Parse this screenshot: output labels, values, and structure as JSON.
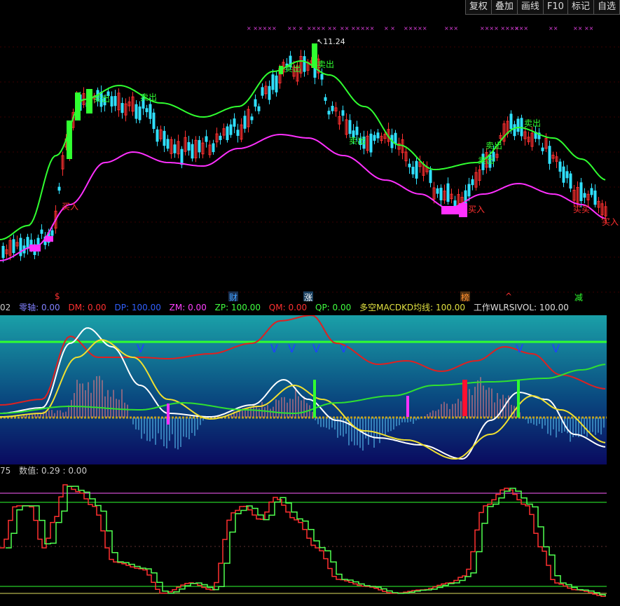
{
  "toolbar": {
    "buttons": [
      "复权",
      "叠加",
      "画线",
      "F10",
      "标记",
      "自选"
    ]
  },
  "main_chart": {
    "high_label": "11.24",
    "signals": [
      {
        "text": "卖出",
        "color": "#30ff30"
      },
      {
        "text": "卖出",
        "color": "#30ff30"
      },
      {
        "text": "卖出",
        "color": "#30ff30"
      },
      {
        "text": "卖出",
        "color": "#30ff30"
      },
      {
        "text": "卖出",
        "color": "#30ff30"
      },
      {
        "text": "卖出",
        "color": "#30ff30"
      },
      {
        "text": "卖出",
        "color": "#30ff30"
      },
      {
        "text": "卖出",
        "color": "#30ff30"
      },
      {
        "text": "买入",
        "color": "#ff3030"
      },
      {
        "text": "买入",
        "color": "#ff3030"
      },
      {
        "text": "买买",
        "color": "#ff3030"
      },
      {
        "text": "买入",
        "color": "#ff3030"
      }
    ],
    "events": [
      {
        "text": "$",
        "color": "#ff3030"
      },
      {
        "text": "财",
        "color": "#40a0ff"
      },
      {
        "text": "涨",
        "color": "#ffffff"
      },
      {
        "text": "榜",
        "color": "#ff9030"
      },
      {
        "text": "^",
        "color": "#ff3030"
      },
      {
        "text": "减",
        "color": "#30ff30"
      }
    ],
    "marks": [
      "× ×××××",
      "×× ×",
      "×××× ××",
      "×× ×××××",
      "× ×",
      "×××××",
      "×××",
      "×××× ××××",
      "×××",
      "××",
      "×× ××"
    ],
    "colors": {
      "upper_band": "#30ff30",
      "lower_band": "#ff30ff",
      "candle_up": "#ff3030",
      "candle_down": "#30e0ff"
    }
  },
  "indicator_bar": {
    "items": [
      {
        "text": "02",
        "color": "#cccccc"
      },
      {
        "text": "零轴: 0.00",
        "color": "#8080ff"
      },
      {
        "text": "DM: 0.00",
        "color": "#ff3030"
      },
      {
        "text": "DP: 100.00",
        "color": "#3060ff"
      },
      {
        "text": "ZM: 0.00",
        "color": "#ff40ff"
      },
      {
        "text": "ZP: 100.00",
        "color": "#40ff40"
      },
      {
        "text": "QM: 0.00",
        "color": "#ff3030"
      },
      {
        "text": "QP: 0.00",
        "color": "#40ff40"
      },
      {
        "text": "多空MACDKD均线: 100.00",
        "color": "#e0e040"
      },
      {
        "text": "工作WLRSIVOL: 100.00",
        "color": "#e0e0e0"
      }
    ]
  },
  "macd_chart": {
    "signals": [
      {
        "text": "V",
        "color": "#2040ff"
      }
    ]
  },
  "value_bar": {
    "items": [
      {
        "text": "75",
        "color": "#cccccc"
      },
      {
        "text": "数值: 0.29 : 0.00",
        "color": "#cccccc"
      }
    ]
  }
}
